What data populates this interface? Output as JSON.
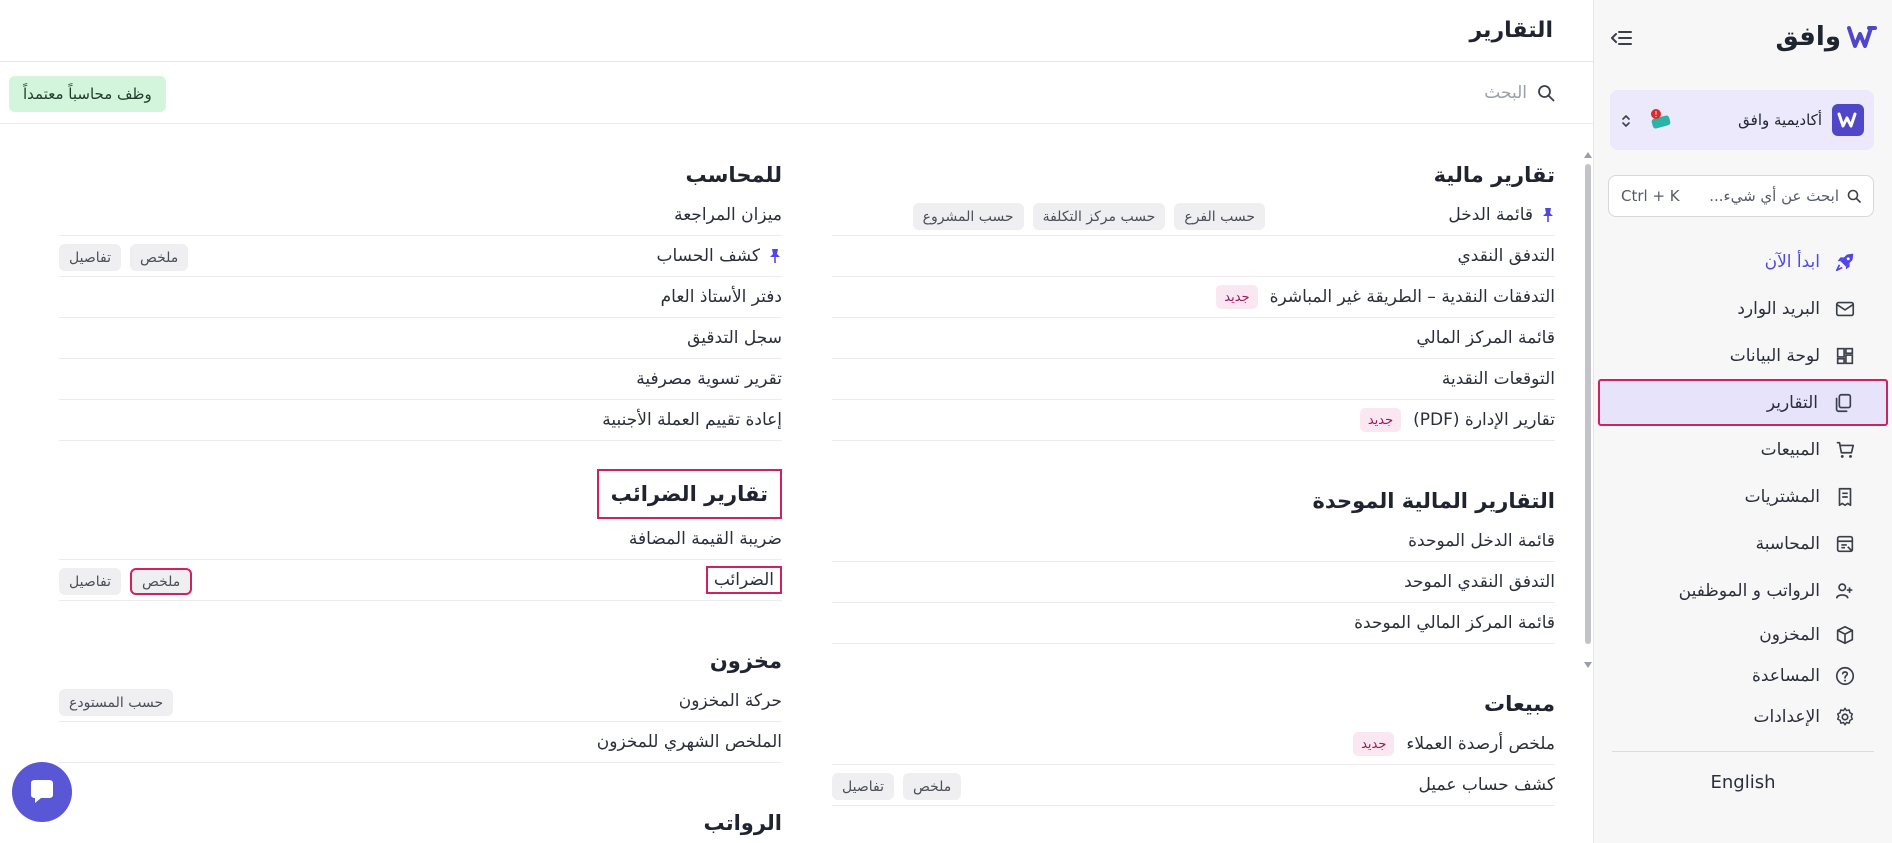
{
  "sidebar": {
    "logo_text": "وافق",
    "org": {
      "name": "أكاديمية وافق"
    },
    "search": {
      "placeholder": "ابحث عن أي شيء...",
      "shortcut": "Ctrl + K"
    },
    "items": [
      {
        "label": "ابدأ الآن",
        "icon": "rocket-icon"
      },
      {
        "label": "البريد الوارد",
        "icon": "inbox-icon"
      },
      {
        "label": "لوحة البيانات",
        "icon": "dashboard-icon"
      },
      {
        "label": "التقارير",
        "icon": "reports-icon"
      },
      {
        "label": "المبيعات",
        "icon": "cart-icon"
      },
      {
        "label": "المشتريات",
        "icon": "receipt-icon"
      },
      {
        "label": "المحاسبة",
        "icon": "ledger-icon"
      },
      {
        "label": "الرواتب و الموظفين",
        "icon": "users-icon"
      },
      {
        "label": "المخزون",
        "icon": "box-icon"
      },
      {
        "label": "المساعدة",
        "icon": "help-icon"
      },
      {
        "label": "الإعدادات",
        "icon": "gear-icon"
      }
    ],
    "language": "English"
  },
  "main": {
    "title": "التقارير",
    "search_placeholder": "البحث",
    "hire_badge": "وظف محاسباً معتمداً",
    "right_column": {
      "financial": {
        "title": "تقارير مالية",
        "rows": [
          {
            "label": "قائمة الدخل",
            "tags": [
              "حسب الفرع",
              "حسب مركز التكلفة",
              "حسب المشروع"
            ]
          },
          {
            "label": "التدفق النقدي"
          },
          {
            "label": "التدفقات النقدية – الطريقة غير المباشرة",
            "new": "جديد"
          },
          {
            "label": "قائمة المركز المالي"
          },
          {
            "label": "التوقعات النقدية"
          },
          {
            "label": "تقارير الإدارة (PDF)",
            "new": "جديد"
          }
        ]
      },
      "consolidated": {
        "title": "التقارير المالية الموحدة",
        "rows": [
          {
            "label": "قائمة الدخل الموحدة"
          },
          {
            "label": "التدفق النقدي الموحد"
          },
          {
            "label": "قائمة المركز المالي الموحدة"
          }
        ]
      },
      "sales": {
        "title": "مبيعات",
        "rows": [
          {
            "label": "ملخص أرصدة العملاء",
            "new": "جديد"
          },
          {
            "label": "كشف حساب عميل",
            "tags": [
              "ملخص",
              "تفاصيل"
            ]
          }
        ]
      }
    },
    "left_column": {
      "accountant": {
        "title": "للمحاسب",
        "rows": [
          {
            "label": "ميزان المراجعة"
          },
          {
            "label": "كشف الحساب",
            "tags": [
              "ملخص",
              "تفاصيل"
            ]
          },
          {
            "label": "دفتر الأستاذ العام"
          },
          {
            "label": "سجل التدقيق"
          },
          {
            "label": "تقرير تسوية مصرفية"
          },
          {
            "label": "إعادة تقييم العملة الأجنبية"
          }
        ]
      },
      "tax": {
        "title": "تقارير الضرائب",
        "rows": [
          {
            "label": "ضريبة القيمة المضافة"
          },
          {
            "label": "الضرائب",
            "tags": [
              "ملخص",
              "تفاصيل"
            ]
          }
        ]
      },
      "inventory": {
        "title": "مخزون",
        "rows": [
          {
            "label": "حركة المخزون",
            "tags": [
              "حسب المستودع"
            ]
          },
          {
            "label": "الملخص الشهري للمخزون"
          }
        ]
      },
      "payroll": {
        "title": "الرواتب"
      }
    }
  },
  "colors": {
    "accent": "#4f46e5",
    "highlight": "#cf2260",
    "green_badge": "#d3f5dc"
  }
}
